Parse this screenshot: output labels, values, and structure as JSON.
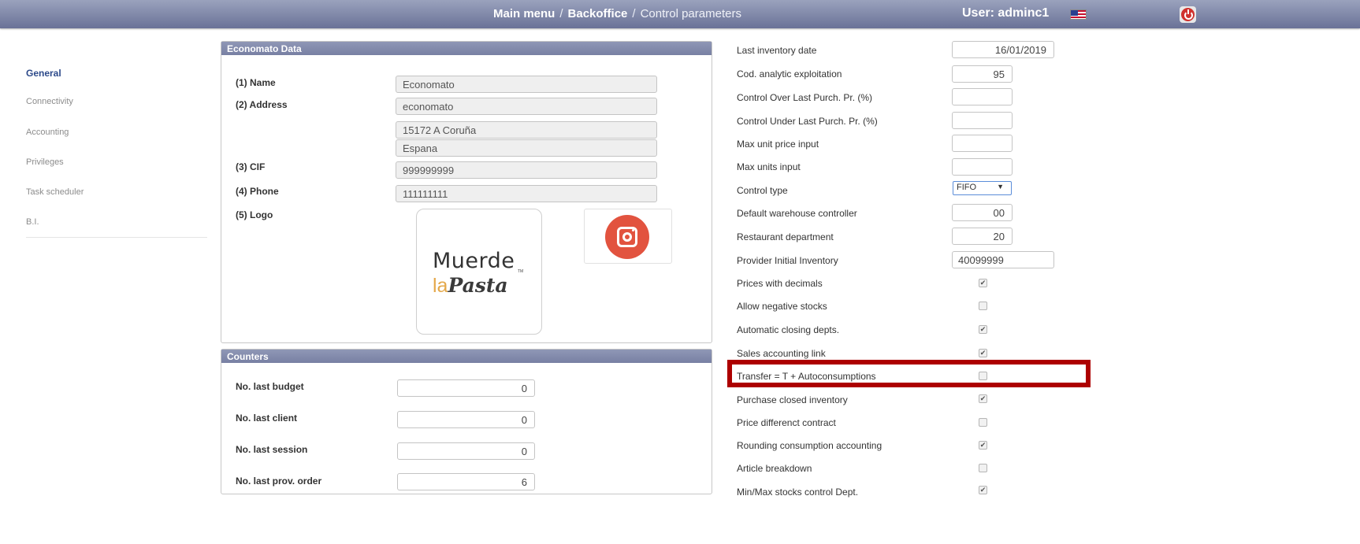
{
  "header": {
    "crumbs": [
      "Main menu",
      "Backoffice",
      "Control parameters"
    ],
    "separator": "/",
    "user": "User: adminc1",
    "flag_icon": "us-flag-icon",
    "logout_icon": "power-icon"
  },
  "sidebar": {
    "items": [
      {
        "label": "General",
        "active": true
      },
      {
        "label": "Connectivity"
      },
      {
        "label": "Accounting"
      },
      {
        "label": "Privileges"
      },
      {
        "label": "Task scheduler"
      },
      {
        "label": "B.I."
      }
    ]
  },
  "economato": {
    "title": "Economato Data",
    "name_label": "(1) Name",
    "name": "Economato",
    "address_label": "(2) Address",
    "address_lines": [
      "economato",
      "15172 A Coruña",
      "Espana"
    ],
    "cif_label": "(3) CIF",
    "cif": "999999999",
    "phone_label": "(4) Phone",
    "phone": "111111111",
    "logo_label": "(5) Logo",
    "logo_text_1": "Muerde",
    "logo_text_la": "la",
    "logo_text_pasta": "Pasta",
    "logo_tm": "TM"
  },
  "counters": {
    "title": "Counters",
    "rows": [
      {
        "label": "No. last budget",
        "value": "0"
      },
      {
        "label": "No. last client",
        "value": "0"
      },
      {
        "label": "No. last session",
        "value": "0"
      },
      {
        "label": "No. last prov. order",
        "value": "6"
      }
    ]
  },
  "params": {
    "last_inventory_date_label": "Last inventory date",
    "last_inventory_date": "16/01/2019",
    "cod_analytic_label": "Cod. analytic exploitation",
    "cod_analytic": "95",
    "control_over_label": "Control Over Last Purch. Pr. (%)",
    "control_over": "",
    "control_under_label": "Control Under Last Purch. Pr. (%)",
    "control_under": "",
    "max_unit_price_label": "Max unit price input",
    "max_unit_price": "",
    "max_units_label": "Max units input",
    "max_units": "",
    "control_type_label": "Control type",
    "control_type": "FIFO",
    "default_wh_label": "Default warehouse controller",
    "default_wh": "00",
    "restaurant_dept_label": "Restaurant department",
    "restaurant_dept": "20",
    "provider_inv_label": "Provider Initial Inventory",
    "provider_inv": "40099999",
    "checks": [
      {
        "label": "Prices with decimals",
        "checked": true
      },
      {
        "label": "Allow negative stocks",
        "checked": false
      },
      {
        "label": "Automatic closing depts.",
        "checked": true
      },
      {
        "label": "Sales accounting link",
        "checked": true
      },
      {
        "label": "Transfer = T + Autoconsumptions",
        "checked": false
      },
      {
        "label": "Purchase closed inventory",
        "checked": true
      },
      {
        "label": "Price differenct contract",
        "checked": false
      },
      {
        "label": "Rounding consumption accounting",
        "checked": true
      },
      {
        "label": "Article breakdown",
        "checked": false
      },
      {
        "label": "Min/Max stocks control Dept.",
        "checked": true
      }
    ],
    "highlight_color": "#ad0000"
  }
}
